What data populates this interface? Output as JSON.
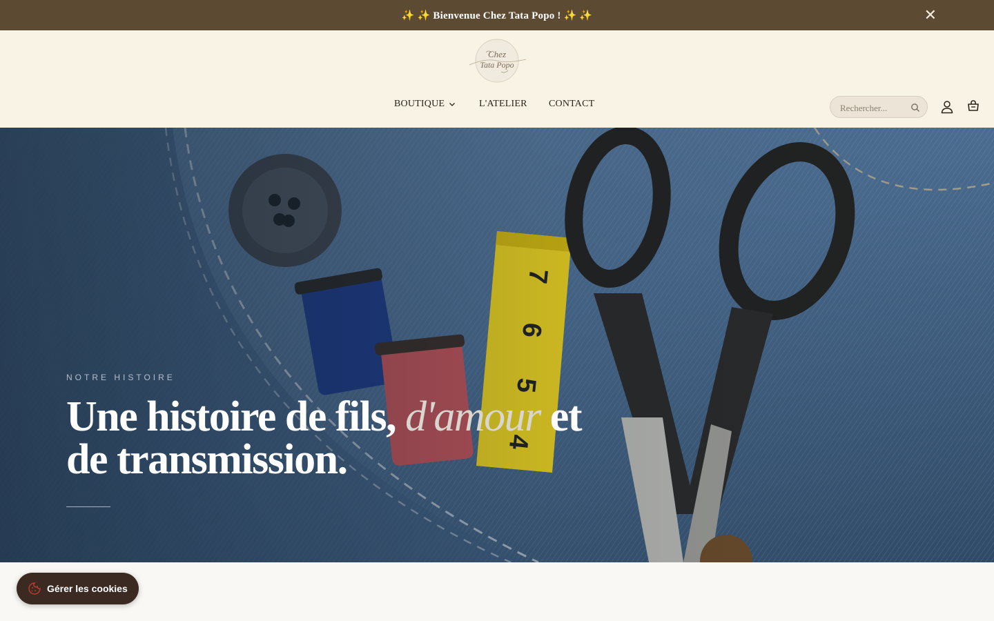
{
  "announcement": {
    "text": "✨  ✨ Bienvenue Chez Tata Popo ! ✨  ✨",
    "close_label": "✕"
  },
  "header": {
    "logo_text": [
      "Chez",
      "Tata Popo"
    ],
    "nav": {
      "boutique": "BOUTIQUE",
      "atelier": "L'ATELIER",
      "contact": "CONTACT"
    },
    "search": {
      "placeholder": "Rechercher..."
    }
  },
  "hero": {
    "eyebrow": "NOTRE HISTOIRE",
    "title_part1": "Une histoire de fils, ",
    "title_italic": "d'amour",
    "title_part2": " et de transmission.",
    "tape_numbers": [
      "7",
      "6",
      "5",
      "4"
    ]
  },
  "cookie": {
    "label": "Gérer les cookies"
  },
  "colors": {
    "announce_bg": "#5c4a32",
    "header_bg": "#f9f3e6",
    "cookie_bg": "#3b2a22",
    "denim": "#4a6a8c"
  }
}
